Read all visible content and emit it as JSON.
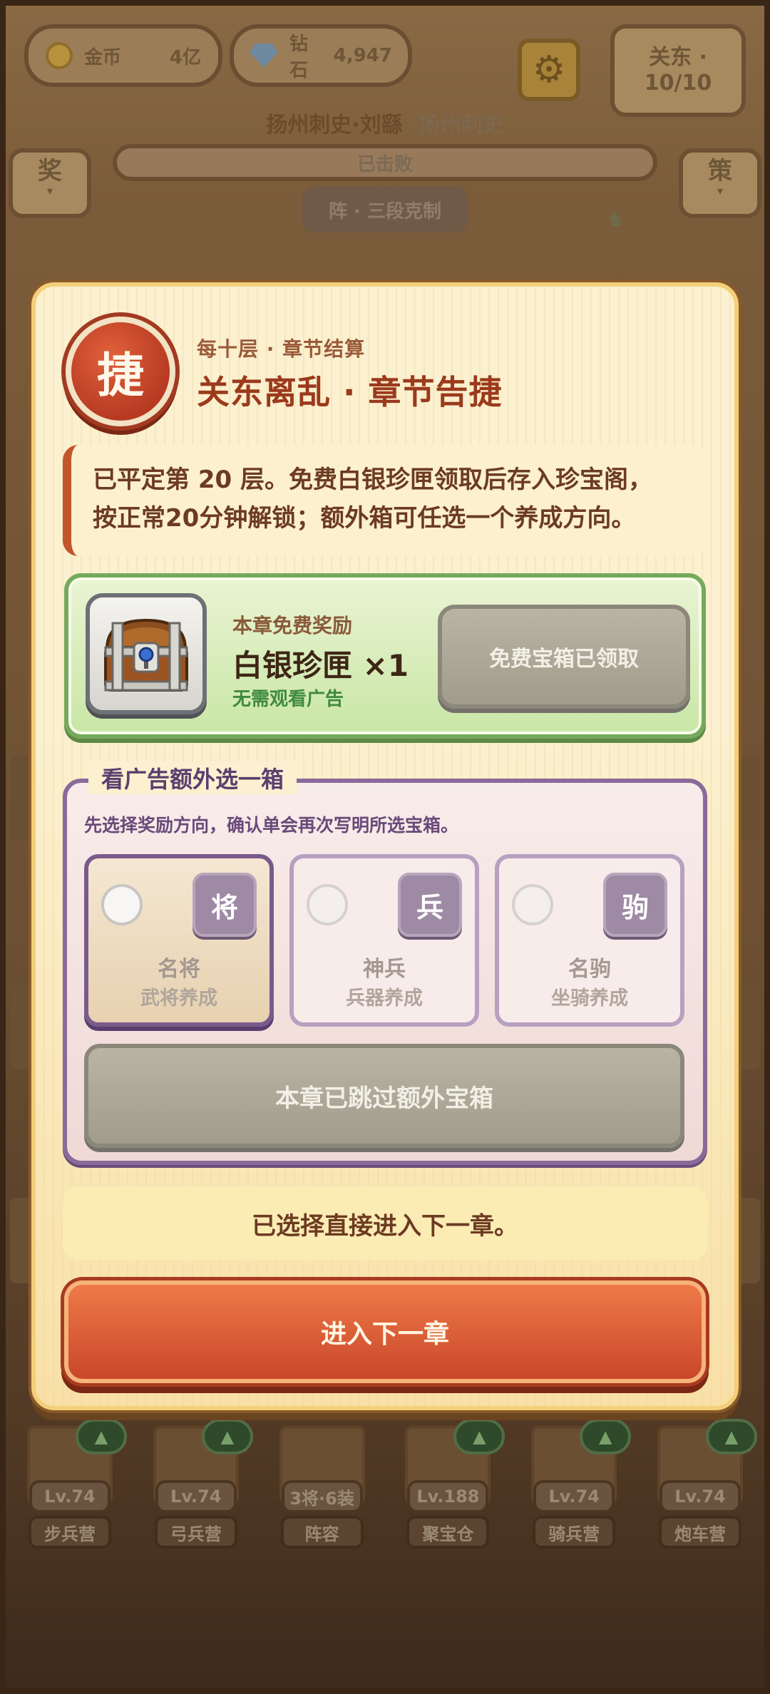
{
  "hud": {
    "coin_label": "金币",
    "coin_value": "4亿",
    "gem_label": "钻石",
    "gem_value": "4,947",
    "stage_title": "关东 ·",
    "stage_progress": "10/10"
  },
  "battle": {
    "enemy_title": "扬州刺史·刘繇",
    "enemy_subtitle": "扬州刺史",
    "hp_status": "已击败",
    "formation": "阵 · 三段克制",
    "reward_btn": "奖",
    "strategy_btn": "策"
  },
  "modal": {
    "seal": "捷",
    "kicker": "每十层 · 章节结算",
    "title": "关东离乱 · 章节告捷",
    "notice_line1": "已平定第 20 层。免费白银珍匣领取后存入珍宝阁，",
    "notice_line2": "按正常20分钟解锁；额外箱可任选一个养成方向。",
    "free_reward": {
      "label": "本章免费奖励",
      "item": "白银珍匣 ×1",
      "note": "无需观看广告",
      "button": "免费宝箱已领取"
    },
    "ad_section": {
      "title": "看广告额外选一箱",
      "hint": "先选择奖励方向，确认单会再次写明所选宝箱。",
      "options": [
        {
          "badge": "将",
          "name": "名将",
          "desc": "武将养成",
          "selected": true
        },
        {
          "badge": "兵",
          "name": "神兵",
          "desc": "兵器养成",
          "selected": false
        },
        {
          "badge": "驹",
          "name": "名驹",
          "desc": "坐骑养成",
          "selected": false
        }
      ],
      "skip_button": "本章已跳过额外宝箱"
    },
    "status": "已选择直接进入下一章。",
    "next_button": "进入下一章"
  },
  "buildings": [
    {
      "level": "Lv.74",
      "name": "步兵营",
      "upgrade": "▲"
    },
    {
      "level": "Lv.74",
      "name": "弓兵营",
      "upgrade": "▲"
    },
    {
      "level": "3将·6装",
      "name": "阵容",
      "upgrade": ""
    },
    {
      "level": "Lv.188",
      "name": "聚宝仓",
      "upgrade": "▲"
    },
    {
      "level": "Lv.74",
      "name": "骑兵营",
      "upgrade": "▲"
    },
    {
      "level": "Lv.74",
      "name": "炮车营",
      "upgrade": "▲"
    }
  ],
  "colors": {
    "accent_red": "#c9472a",
    "confirm_green": "#75a95c",
    "purple_frame": "#8a6a9a",
    "disabled_gray": "#a19c8c"
  },
  "icons": [
    "coin-icon",
    "gem-icon",
    "gear-icon",
    "treasure-chest-icon",
    "radio-icon",
    "upgrade-arrow-icon"
  ]
}
